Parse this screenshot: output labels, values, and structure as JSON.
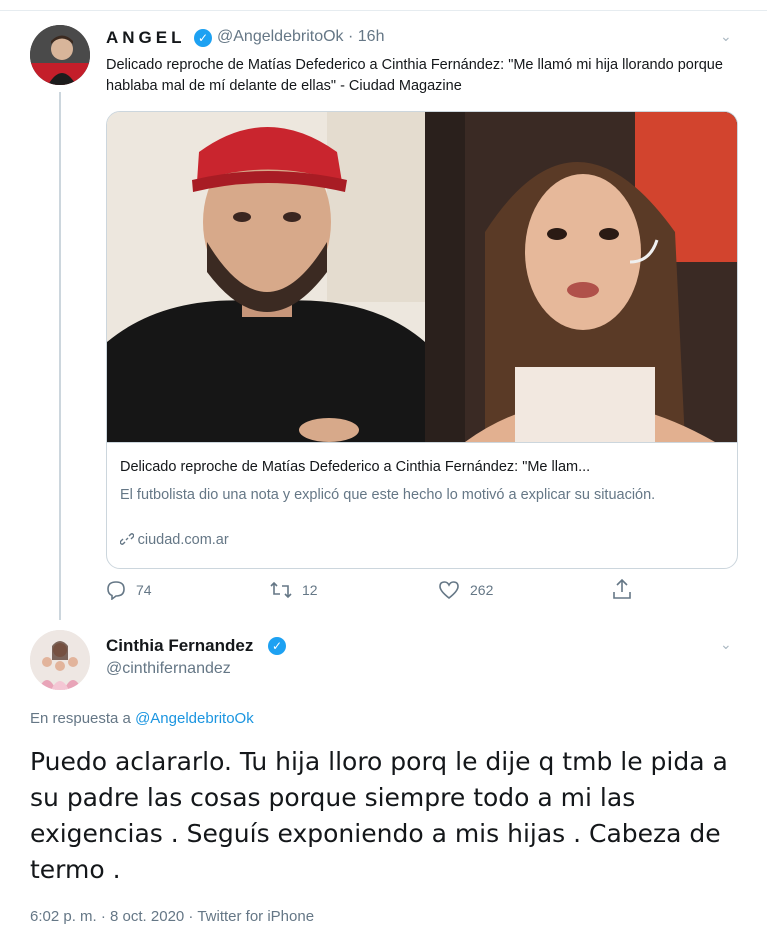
{
  "tweet1": {
    "author_name": "ANGEL",
    "handle": "@AngeldebritoOk",
    "separator": "·",
    "time": "16h",
    "text": "Delicado reproche de Matías Defederico a Cinthia Fernández: \"Me llamó mi hija llorando porque hablaba mal de mí delante de ellas\" - Ciudad Magazine",
    "card": {
      "title": "Delicado reproche de Matías Defederico a Cinthia Fernández: \"Me llam...",
      "description": "El futbolista dio una nota y explicó que este hecho lo motivó a explicar su situación.",
      "domain": "ciudad.com.ar"
    },
    "actions": {
      "replies": "74",
      "retweets": "12",
      "likes": "262"
    }
  },
  "tweet2": {
    "author_name": "Cinthia Fernandez",
    "handle": "@cinthifernandez",
    "reply_prefix": "En respuesta a",
    "reply_mention": "@AngeldebritoOk",
    "text": "Puedo aclararlo. Tu hija lloro porq le dije q tmb le pida a su padre las cosas porque siempre todo a mi las exigencias . Seguís exponiendo a mis hijas . Cabeza de termo .",
    "timestamp": "6:02 p. m. · 8 oct. 2020 · Twitter for iPhone"
  },
  "icons": {
    "verified": "✓",
    "chevron": "⌄",
    "reply": "◯",
    "retweet": "⟲",
    "like": "♡",
    "share": "⇪",
    "link": "🔗"
  },
  "colors": {
    "accent": "#1da1f2",
    "link": "#1b95e0",
    "muted": "#657786",
    "border": "#ccd6dd"
  }
}
